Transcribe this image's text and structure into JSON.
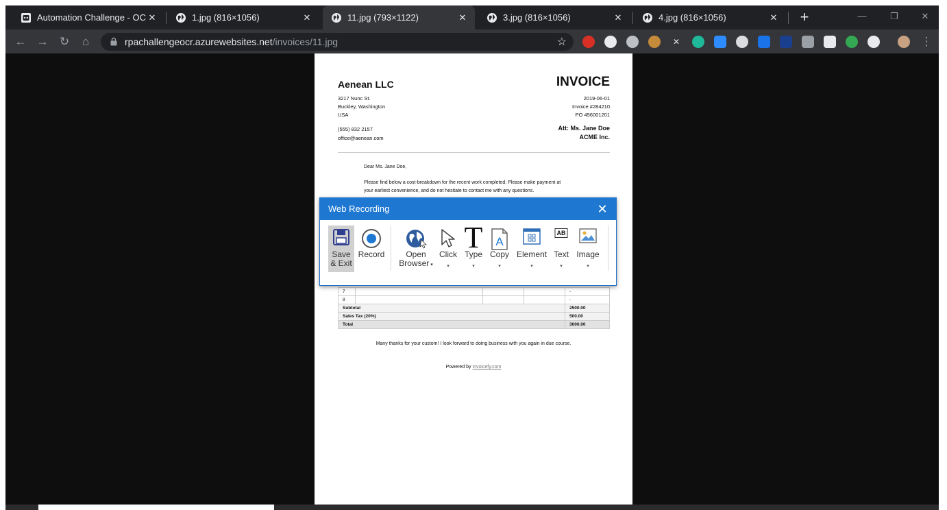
{
  "browser": {
    "tabs": [
      {
        "title": "Automation Challenge - OCR",
        "active": false,
        "favicon": "robot-icon"
      },
      {
        "title": "1.jpg (816×1056)",
        "active": false,
        "favicon": "globe-icon"
      },
      {
        "title": "11.jpg (793×1122)",
        "active": true,
        "favicon": "globe-icon"
      },
      {
        "title": "3.jpg (816×1056)",
        "active": false,
        "favicon": "globe-icon"
      },
      {
        "title": "4.jpg (816×1056)",
        "active": false,
        "favicon": "globe-icon"
      }
    ],
    "url_host": "rpachallengeocr.azurewebsites.net",
    "url_path": "/invoices/11.jpg",
    "new_tab": "+"
  },
  "invoice": {
    "company": "Aenean LLC",
    "title": "INVOICE",
    "address": [
      "3217 Nunc St.",
      "Buckley, Washington",
      "USA"
    ],
    "contact": [
      "(555) 832 2157",
      "office@aenean.com"
    ],
    "date": "2019-06-01",
    "number": "Invoice #284210",
    "po": "PO 456001201",
    "att": "Att: Ms. Jane Doe",
    "client": "ACME Inc.",
    "greeting": "Dear Ms. Jane Doe,",
    "body_line1": "Please find below a cost-breakdown for the recent work completed. Please make payment at",
    "body_line2": "your earliest convenience, and do not hesitate to contact me with any questions.",
    "rows": [
      {
        "num": "7",
        "amount": "-"
      },
      {
        "num": "8",
        "amount": "-"
      }
    ],
    "subtotal_label": "Subtotal",
    "subtotal": "2500.00",
    "tax_label": "Sales Tax (20%)",
    "tax": "500.00",
    "total_label": "Total",
    "total": "3000.00",
    "thanks": "Many thanks for your custom! I look forward to doing business with you again in due course.",
    "powered_by": "Powered by",
    "powered_link": "invoicefy.com"
  },
  "dialog": {
    "title": "Web Recording",
    "buttons": {
      "save_line1": "Save",
      "save_line2": "& Exit",
      "record": "Record",
      "open_line1": "Open",
      "open_line2": "Browser",
      "click": "Click",
      "type": "Type",
      "copy": "Copy",
      "element": "Element",
      "text": "Text",
      "image": "Image"
    },
    "text_icon_label": "AB",
    "type_icon_glyph": "T",
    "copy_icon_glyph": "A"
  },
  "colors": {
    "accent": "#1e78d2",
    "chrome_dark": "#202124",
    "chrome_toolbar": "#35363a"
  }
}
